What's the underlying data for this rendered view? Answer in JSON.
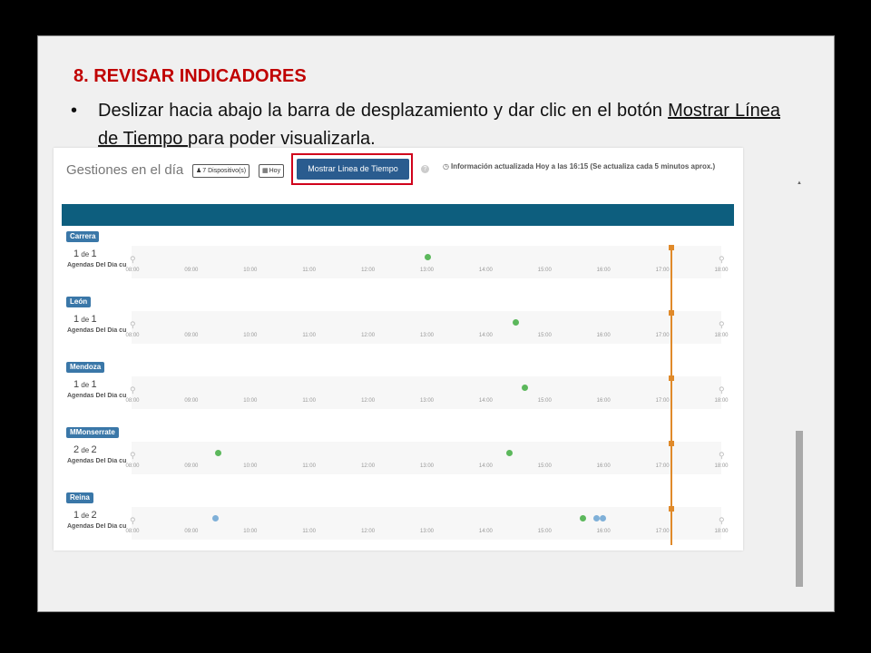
{
  "slide": {
    "heading": "8. REVISAR INDICADORES",
    "bullet": "•",
    "text_before": "Deslizar hacia abajo la barra de desplazamiento y dar clic en el botón ",
    "link_text": "Mostrar Línea de Tiempo ",
    "text_after": "para poder visualizarla."
  },
  "screenshot": {
    "title": "Gestiones en el día",
    "devices_chip": "7 Dispositivo(s)",
    "today_chip": "Hoy",
    "main_button": "Mostrar Linea de Tiempo",
    "help": "?",
    "info": "Información actualizada Hoy a las 16:15 (Se actualiza cada 5 minutos aprox.)",
    "hours": [
      "08:00",
      "09:00",
      "10:00",
      "11:00",
      "12:00",
      "13:00",
      "14:00",
      "15:00",
      "16:00",
      "17:00",
      "18:00"
    ],
    "rows": [
      {
        "label": "Carrera",
        "count": "1",
        "of": "de",
        "total": "1",
        "agenda": "Agendas Del Día cur",
        "green": [
          13.0
        ],
        "blue": []
      },
      {
        "label": "León",
        "count": "1",
        "of": "de",
        "total": "1",
        "agenda": "Agendas Del Día cur",
        "green": [
          14.5
        ],
        "blue": []
      },
      {
        "label": "Mendoza",
        "count": "1",
        "of": "de",
        "total": "1",
        "agenda": "Agendas Del Día cur",
        "green": [
          14.65
        ],
        "blue": []
      },
      {
        "label": "MMonserrate",
        "count": "2",
        "of": "de",
        "total": "2",
        "agenda": "Agendas Del Día cur",
        "green": [
          9.45,
          14.4
        ],
        "blue": []
      },
      {
        "label": "Reina",
        "count": "1",
        "of": "de",
        "total": "2",
        "agenda": "Agendas Del Día cur",
        "green": [
          15.65
        ],
        "blue": [
          9.4,
          15.88,
          15.98
        ]
      }
    ],
    "now_hour": 17.15,
    "colors": {
      "accent": "#2a5c8f",
      "header_bar": "#0d5e7e",
      "highlight": "#d0021b",
      "now": "#e08a2a"
    }
  }
}
